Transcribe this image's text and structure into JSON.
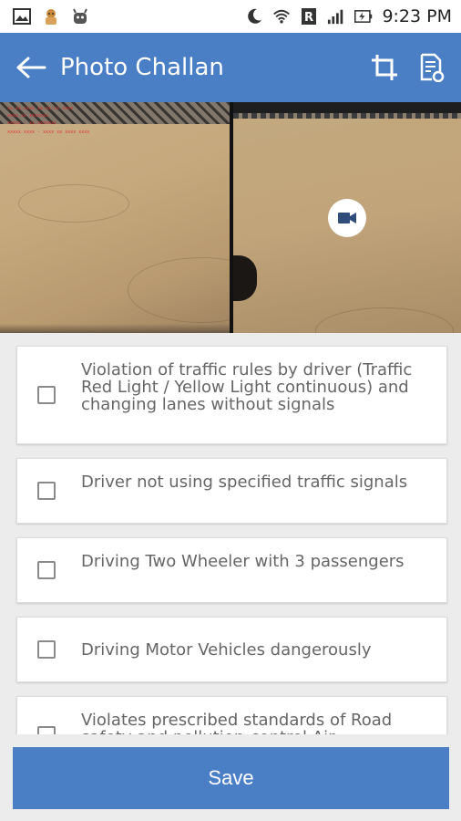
{
  "status_bar": {
    "time": "9:23 PM",
    "left_icons": [
      "image-icon",
      "app-icon",
      "android-icon"
    ],
    "right_icons": [
      "moon-icon",
      "wifi-icon",
      "roaming-icon",
      "signal-icon",
      "battery-charging-icon"
    ]
  },
  "app_bar": {
    "title": "Photo Challan",
    "back_icon": "arrow-left-icon",
    "actions": [
      "crop-icon",
      "document-settings-icon"
    ],
    "color": "#4a7fc6"
  },
  "media": {
    "photos": [
      {
        "type": "image",
        "overlay_lines": [
          "xx.xx.xxxx xx:xx:xx xxxx",
          "xxxx xx xxxxxxx",
          "xxxxx : xx.xxxxxxx",
          "xxxxx xxxx - xxxx xx xxxx xxxx"
        ]
      },
      {
        "type": "video",
        "badge_icon": "video-camera-icon"
      }
    ]
  },
  "violations": [
    {
      "label": "Violation of traffic rules by driver (Traffic Red Light / Yellow Light continuous) and changing lanes without signals",
      "checked": false
    },
    {
      "label": "Driver not using specified traffic signals",
      "checked": false
    },
    {
      "label": "Driving Two Wheeler with 3 passengers",
      "checked": false
    },
    {
      "label": "Driving Motor Vehicles dangerously",
      "checked": false
    },
    {
      "label": "Violates prescribed standards of Road safety and pollution-control Air",
      "checked": false
    }
  ],
  "footer": {
    "save_label": "Save"
  }
}
